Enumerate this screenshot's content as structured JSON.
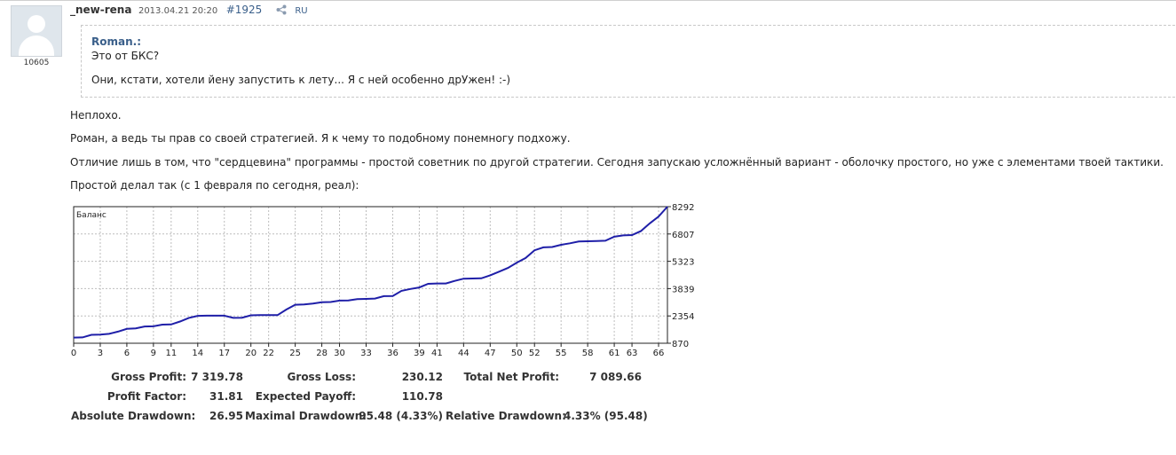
{
  "post": {
    "author": "_new-rena",
    "date": "2013.04.21 20:20",
    "number": "#1925",
    "lang": "RU",
    "rating": "10605"
  },
  "quote": {
    "author": "Roman.:",
    "line1": "Это от БКС?",
    "line2": "Они, кстати, хотели йену запустить к лету... Я с ней особенно дрУжен! :-)"
  },
  "body": {
    "p1": "Неплохо.",
    "p2": "Роман, а ведь ты прав со своей стратегией. Я к чему то подобному понемногу подхожу.",
    "p3": "Отличие лишь в том, что \"сердцевина\" программы - простой советник по другой стратегии. Сегодня запускаю усложнённый вариант - оболочку простого, но уже с элементами твоей тактики.",
    "p4": "Простой делал так (с 1 февраля по сегодня, реал):"
  },
  "colors": {
    "link": "#3a5f8a",
    "line": "#1f1fa8",
    "grid": "#bdbdbd"
  },
  "chart_data": {
    "type": "line",
    "title": "Баланс",
    "x_ticks": [
      0,
      3,
      6,
      9,
      11,
      14,
      17,
      20,
      22,
      25,
      28,
      30,
      33,
      36,
      39,
      41,
      44,
      47,
      50,
      52,
      55,
      58,
      61,
      63,
      66
    ],
    "y_ticks": [
      "8292",
      "6807",
      "5323",
      "3839",
      "2354",
      "870"
    ],
    "xlim": [
      0,
      67
    ],
    "ylim": [
      870,
      8292
    ],
    "grid": true,
    "x": [
      0,
      1,
      2,
      3,
      4,
      5,
      6,
      7,
      8,
      9,
      10,
      11,
      12,
      13,
      14,
      15,
      16,
      17,
      18,
      19,
      20,
      21,
      22,
      23,
      24,
      25,
      26,
      27,
      28,
      29,
      30,
      31,
      32,
      33,
      34,
      35,
      36,
      37,
      38,
      39,
      40,
      41,
      42,
      43,
      44,
      45,
      46,
      47,
      48,
      49,
      50,
      51,
      52,
      53,
      54,
      55,
      56,
      57,
      58,
      59,
      60,
      61,
      62,
      63,
      64,
      65,
      66,
      67
    ],
    "values": [
      1180,
      1190,
      1330,
      1340,
      1380,
      1500,
      1650,
      1680,
      1780,
      1790,
      1880,
      1890,
      2050,
      2250,
      2360,
      2370,
      2370,
      2370,
      2250,
      2260,
      2390,
      2400,
      2400,
      2400,
      2700,
      2960,
      2980,
      3030,
      3100,
      3110,
      3190,
      3200,
      3270,
      3280,
      3300,
      3430,
      3440,
      3720,
      3820,
      3900,
      4100,
      4120,
      4120,
      4260,
      4380,
      4390,
      4400,
      4560,
      4760,
      4960,
      5250,
      5500,
      5920,
      6080,
      6100,
      6220,
      6300,
      6400,
      6410,
      6420,
      6440,
      6660,
      6730,
      6750,
      6960,
      7380,
      7750,
      8292
    ]
  },
  "stats": {
    "gross_profit_label": "Gross Profit:",
    "gross_profit_value": "7 319.78",
    "gross_loss_label": "Gross Loss:",
    "gross_loss_value": "230.12",
    "total_net_profit_label": "Total Net Profit:",
    "total_net_profit_value": "7 089.66",
    "profit_factor_label": "Profit Factor:",
    "profit_factor_value": "31.81",
    "expected_payoff_label": "Expected Payoff:",
    "expected_payoff_value": "110.78",
    "absolute_drawdown_label": "Absolute Drawdown:",
    "absolute_drawdown_value": "26.95",
    "maximal_drawdown_label": "Maximal Drawdown:",
    "maximal_drawdown_value": "95.48 (4.33%)",
    "relative_drawdown_label": "Relative Drawdown:",
    "relative_drawdown_value": "4.33% (95.48)"
  }
}
